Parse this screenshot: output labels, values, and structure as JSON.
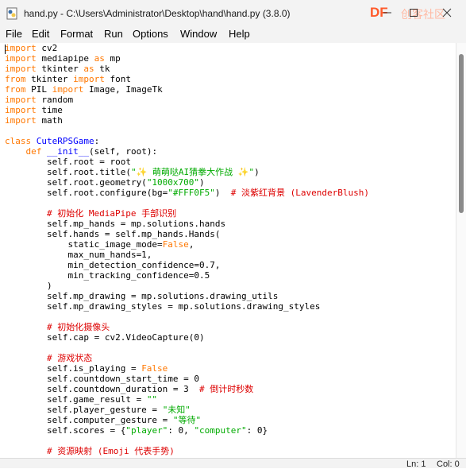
{
  "window": {
    "title": "hand.py - C:\\Users\\Administrator\\Desktop\\hand\\hand.py (3.8.0)"
  },
  "watermark": {
    "brand": "DF",
    "text": "创客社区"
  },
  "menu": [
    "File",
    "Edit",
    "Format",
    "Run",
    "Options",
    "Window",
    "Help"
  ],
  "code_lines": [
    [
      {
        "t": "kw",
        "v": "import"
      },
      {
        "t": "",
        "v": " cv2"
      }
    ],
    [
      {
        "t": "kw",
        "v": "import"
      },
      {
        "t": "",
        "v": " mediapipe "
      },
      {
        "t": "kw",
        "v": "as"
      },
      {
        "t": "",
        "v": " mp"
      }
    ],
    [
      {
        "t": "kw",
        "v": "import"
      },
      {
        "t": "",
        "v": " tkinter "
      },
      {
        "t": "kw",
        "v": "as"
      },
      {
        "t": "",
        "v": " tk"
      }
    ],
    [
      {
        "t": "kw",
        "v": "from"
      },
      {
        "t": "",
        "v": " tkinter "
      },
      {
        "t": "kw",
        "v": "import"
      },
      {
        "t": "",
        "v": " font"
      }
    ],
    [
      {
        "t": "kw",
        "v": "from"
      },
      {
        "t": "",
        "v": " PIL "
      },
      {
        "t": "kw",
        "v": "import"
      },
      {
        "t": "",
        "v": " Image, ImageTk"
      }
    ],
    [
      {
        "t": "kw",
        "v": "import"
      },
      {
        "t": "",
        "v": " random"
      }
    ],
    [
      {
        "t": "kw",
        "v": "import"
      },
      {
        "t": "",
        "v": " time"
      }
    ],
    [
      {
        "t": "kw",
        "v": "import"
      },
      {
        "t": "",
        "v": " math"
      }
    ],
    [],
    [
      {
        "t": "kw",
        "v": "class"
      },
      {
        "t": "",
        "v": " "
      },
      {
        "t": "def",
        "v": "CuteRPSGame"
      },
      {
        "t": "",
        "v": ":"
      }
    ],
    [
      {
        "t": "",
        "v": "    "
      },
      {
        "t": "kw",
        "v": "def"
      },
      {
        "t": "",
        "v": " "
      },
      {
        "t": "def",
        "v": "__init__"
      },
      {
        "t": "",
        "v": "(self, root):"
      }
    ],
    [
      {
        "t": "",
        "v": "        self.root = root"
      }
    ],
    [
      {
        "t": "",
        "v": "        self.root.title("
      },
      {
        "t": "str",
        "v": "\"✨ 萌萌哒AI猜拳大作战 ✨\""
      },
      {
        "t": "",
        "v": ")"
      }
    ],
    [
      {
        "t": "",
        "v": "        self.root.geometry("
      },
      {
        "t": "str",
        "v": "\"1000x700\""
      },
      {
        "t": "",
        "v": ")"
      }
    ],
    [
      {
        "t": "",
        "v": "        self.root.configure(bg="
      },
      {
        "t": "str",
        "v": "\"#FFF0F5\""
      },
      {
        "t": "",
        "v": ")  "
      },
      {
        "t": "cm",
        "v": "# 淡紫红背景 (LavenderBlush)"
      }
    ],
    [],
    [
      {
        "t": "",
        "v": "        "
      },
      {
        "t": "cm",
        "v": "# 初始化 MediaPipe 手部识别"
      }
    ],
    [
      {
        "t": "",
        "v": "        self.mp_hands = mp.solutions.hands"
      }
    ],
    [
      {
        "t": "",
        "v": "        self.hands = self.mp_hands.Hands("
      }
    ],
    [
      {
        "t": "",
        "v": "            static_image_mode="
      },
      {
        "t": "kw",
        "v": "False"
      },
      {
        "t": "",
        "v": ","
      }
    ],
    [
      {
        "t": "",
        "v": "            max_num_hands=1,"
      }
    ],
    [
      {
        "t": "",
        "v": "            min_detection_confidence=0.7,"
      }
    ],
    [
      {
        "t": "",
        "v": "            min_tracking_confidence=0.5"
      }
    ],
    [
      {
        "t": "",
        "v": "        )"
      }
    ],
    [
      {
        "t": "",
        "v": "        self.mp_drawing = mp.solutions.drawing_utils"
      }
    ],
    [
      {
        "t": "",
        "v": "        self.mp_drawing_styles = mp.solutions.drawing_styles"
      }
    ],
    [],
    [
      {
        "t": "",
        "v": "        "
      },
      {
        "t": "cm",
        "v": "# 初始化摄像头"
      }
    ],
    [
      {
        "t": "",
        "v": "        self.cap = cv2.VideoCapture(0)"
      }
    ],
    [],
    [
      {
        "t": "",
        "v": "        "
      },
      {
        "t": "cm",
        "v": "# 游戏状态"
      }
    ],
    [
      {
        "t": "",
        "v": "        self.is_playing = "
      },
      {
        "t": "kw",
        "v": "False"
      }
    ],
    [
      {
        "t": "",
        "v": "        self.countdown_start_time = 0"
      }
    ],
    [
      {
        "t": "",
        "v": "        self.countdown_duration = 3  "
      },
      {
        "t": "cm",
        "v": "# 倒计时秒数"
      }
    ],
    [
      {
        "t": "",
        "v": "        self.game_result = "
      },
      {
        "t": "str",
        "v": "\"\""
      }
    ],
    [
      {
        "t": "",
        "v": "        self.player_gesture = "
      },
      {
        "t": "str",
        "v": "\"未知\""
      }
    ],
    [
      {
        "t": "",
        "v": "        self.computer_gesture = "
      },
      {
        "t": "str",
        "v": "\"等待\""
      }
    ],
    [
      {
        "t": "",
        "v": "        self.scores = {"
      },
      {
        "t": "str",
        "v": "\"player\""
      },
      {
        "t": "",
        "v": ": 0, "
      },
      {
        "t": "str",
        "v": "\"computer\""
      },
      {
        "t": "",
        "v": ": 0}"
      }
    ],
    [],
    [
      {
        "t": "",
        "v": "        "
      },
      {
        "t": "cm",
        "v": "# 资源映射 (Emoji 代表手势)"
      }
    ]
  ],
  "status": {
    "line": "Ln: 1",
    "col": "Col: 0"
  }
}
